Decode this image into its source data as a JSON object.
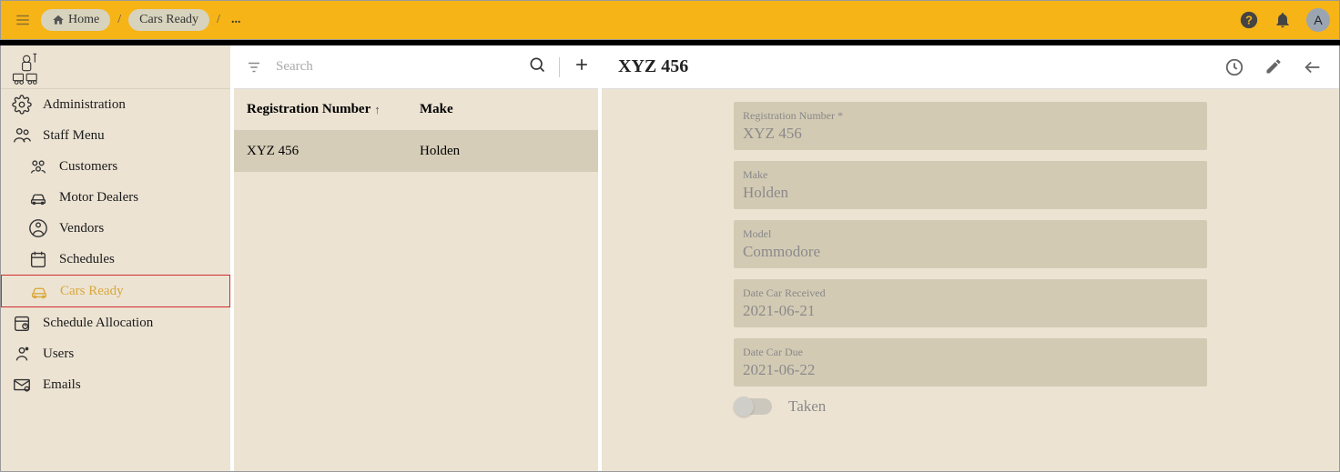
{
  "topbar": {
    "breadcrumb": {
      "home": "Home",
      "current": "Cars Ready",
      "more": "..."
    },
    "avatar_letter": "A"
  },
  "sidebar": {
    "items": [
      {
        "label": "Administration"
      },
      {
        "label": "Staff Menu"
      },
      {
        "label": "Customers"
      },
      {
        "label": "Motor Dealers"
      },
      {
        "label": "Vendors"
      },
      {
        "label": "Schedules"
      },
      {
        "label": "Cars Ready"
      },
      {
        "label": "Schedule Allocation"
      },
      {
        "label": "Users"
      },
      {
        "label": "Emails"
      }
    ]
  },
  "list": {
    "search_placeholder": "Search",
    "columns": {
      "reg": "Registration Number",
      "make": "Make"
    },
    "sort_indicator": "↑",
    "rows": [
      {
        "reg": "XYZ 456",
        "make": "Holden"
      }
    ]
  },
  "detail": {
    "title": "XYZ 456",
    "fields": [
      {
        "label": "Registration Number *",
        "value": "XYZ 456"
      },
      {
        "label": "Make",
        "value": "Holden"
      },
      {
        "label": "Model",
        "value": "Commodore"
      },
      {
        "label": "Date Car Received",
        "value": "2021-06-21"
      },
      {
        "label": "Date Car Due",
        "value": "2021-06-22"
      }
    ],
    "toggle": {
      "label": "Taken",
      "checked": false
    }
  }
}
